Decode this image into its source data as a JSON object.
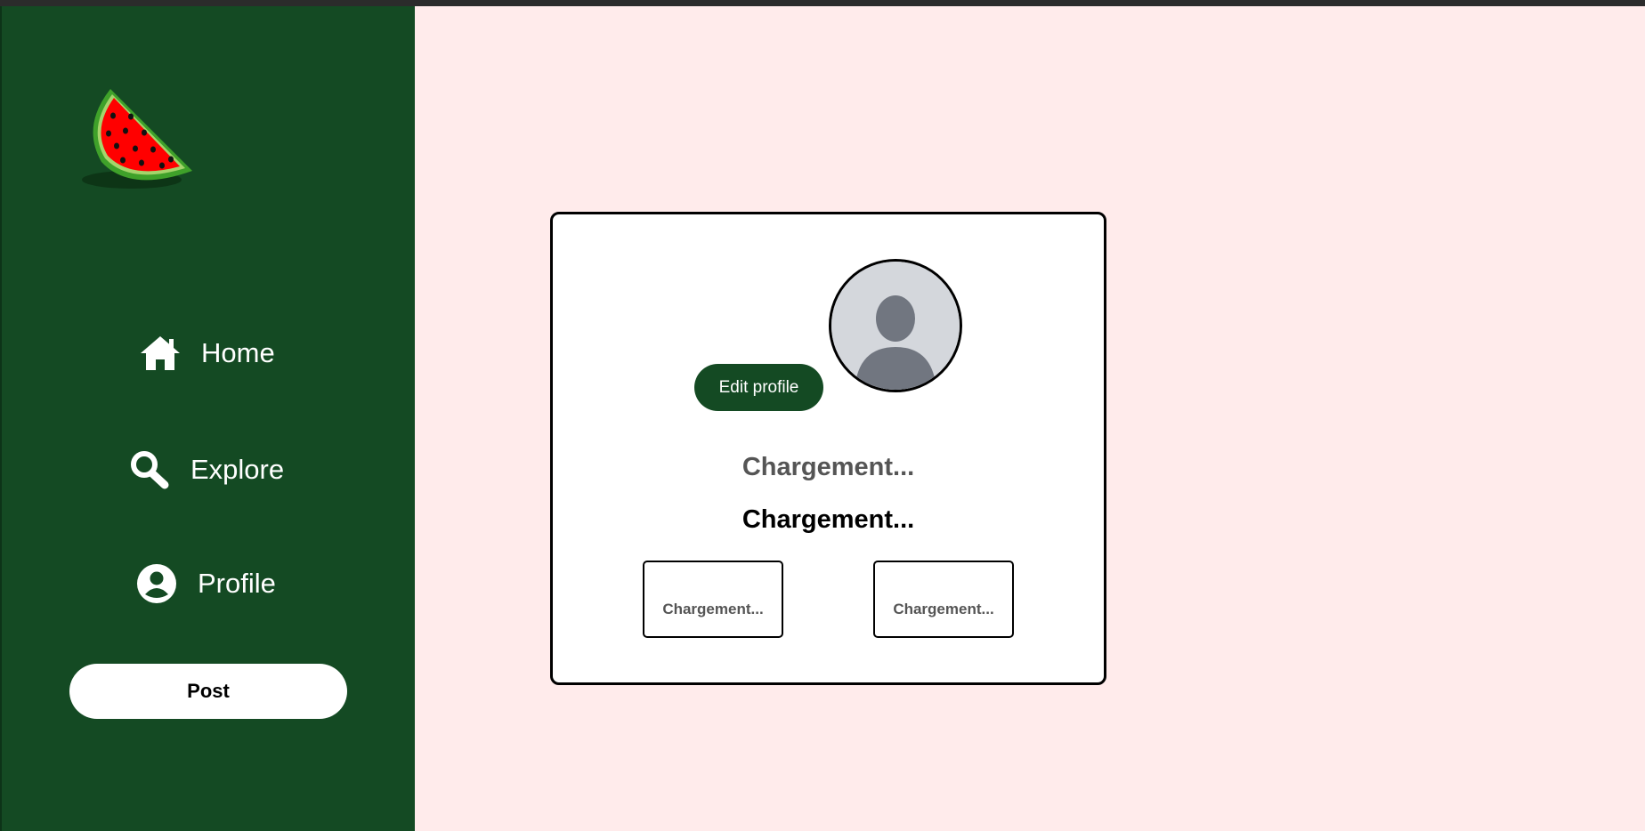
{
  "sidebar": {
    "logo_icon": "watermelon-slice-icon",
    "nav": [
      {
        "label": "Home",
        "icon": "home-icon"
      },
      {
        "label": "Explore",
        "icon": "search-icon"
      },
      {
        "label": "Profile",
        "icon": "user-circle-icon"
      }
    ],
    "post_label": "Post"
  },
  "profile": {
    "avatar_icon": "default-avatar-icon",
    "edit_label": "Edit profile",
    "display_name": "Chargement...",
    "username": "Chargement...",
    "stats": [
      {
        "value": "Chargement..."
      },
      {
        "value": "Chargement..."
      }
    ]
  },
  "colors": {
    "sidebar_bg": "#144a23",
    "page_bg": "#ffebeb",
    "card_bg": "#ffffff",
    "accent": "#144a23"
  }
}
